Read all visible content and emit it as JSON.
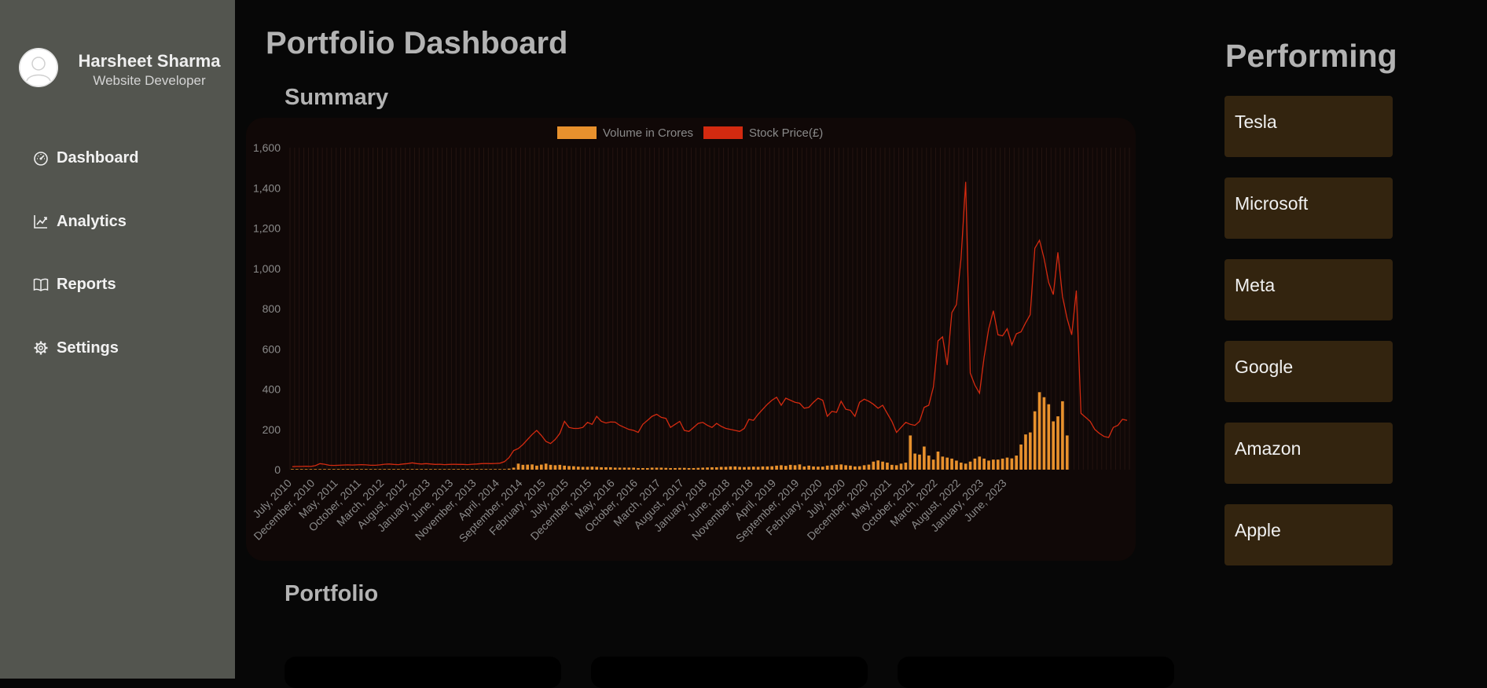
{
  "sidebar": {
    "user": {
      "name": "Harsheet Sharma",
      "role": "Website Developer"
    },
    "items": [
      {
        "label": "Dashboard",
        "icon": "gauge-icon"
      },
      {
        "label": "Analytics",
        "icon": "line-chart-icon"
      },
      {
        "label": "Reports",
        "icon": "book-icon"
      },
      {
        "label": "Settings",
        "icon": "gear-icon"
      }
    ]
  },
  "main": {
    "title": "Portfolio Dashboard",
    "summary_heading": "Summary",
    "portfolio_heading": "Portfolio"
  },
  "performing": {
    "title": "Performing",
    "items": [
      "Tesla",
      "Microsoft",
      "Meta",
      "Google",
      "Amazon",
      "Apple"
    ]
  },
  "colors": {
    "volume": "#e8912d",
    "price": "#d32a10",
    "sidebar_bg": "#53554f",
    "card_bg": "#33240f"
  },
  "chart_data": {
    "type": "bar",
    "legend": {
      "position": "top-center",
      "entries": [
        "Volume in Crores",
        "Stock Price(£)"
      ]
    },
    "ylim": [
      0,
      1600
    ],
    "y_ticks": [
      "0",
      "200",
      "400",
      "600",
      "800",
      "1,000",
      "1,200",
      "1,400",
      "1,600"
    ],
    "x_tick_labels": [
      "July, 2010",
      "December, 2010",
      "May, 2011",
      "October, 2011",
      "March, 2012",
      "August, 2012",
      "January, 2013",
      "June, 2013",
      "November, 2013",
      "April, 2014",
      "September, 2014",
      "February, 2015",
      "July, 2015",
      "December, 2015",
      "May, 2016",
      "October, 2016",
      "March, 2017",
      "August, 2017",
      "January, 2018",
      "June, 2018",
      "November, 2018",
      "April, 2019",
      "September, 2019",
      "February, 2020",
      "July, 2020",
      "December, 2020",
      "May, 2021",
      "October, 2021",
      "March, 2022",
      "August, 2022",
      "January, 2023",
      "June, 2023"
    ],
    "x_start": "July, 2010",
    "x_end": "August, 2023",
    "grid": true,
    "series": [
      {
        "name": "Volume in Crores",
        "type": "bar",
        "color": "#e8912d",
        "values": [
          3,
          3,
          3,
          3,
          3,
          3,
          3,
          3,
          3,
          3,
          3,
          3,
          3,
          3,
          3,
          3,
          3,
          3,
          3,
          3,
          3,
          3,
          3,
          3,
          3,
          3,
          3,
          3,
          3,
          3,
          3,
          3,
          3,
          3,
          3,
          3,
          3,
          3,
          3,
          3,
          3,
          3,
          3,
          3,
          3,
          3,
          3,
          5,
          10,
          30,
          24,
          25,
          26,
          20,
          25,
          30,
          24,
          22,
          24,
          20,
          18,
          17,
          15,
          14,
          14,
          15,
          14,
          12,
          12,
          12,
          10,
          10,
          10,
          10,
          10,
          8,
          8,
          8,
          10,
          10,
          10,
          9,
          8,
          8,
          9,
          9,
          8,
          8,
          9,
          10,
          11,
          12,
          12,
          14,
          14,
          16,
          16,
          14,
          13,
          14,
          15,
          14,
          16,
          16,
          17,
          20,
          22,
          19,
          24,
          22,
          26,
          16,
          20,
          16,
          15,
          15,
          20,
          22,
          24,
          26,
          22,
          20,
          16,
          17,
          22,
          25,
          40,
          46,
          40,
          35,
          24,
          22,
          30,
          35,
          170,
          80,
          75,
          115,
          70,
          50,
          90,
          65,
          60,
          55,
          45,
          35,
          30,
          40,
          55,
          65,
          55,
          45,
          50,
          50,
          55,
          60,
          56,
          70,
          125,
          175,
          185,
          290,
          385,
          360,
          325,
          240,
          265,
          340,
          170
        ]
      },
      {
        "name": "Stock Price(£)",
        "type": "line",
        "color": "#d32a10",
        "values": [
          15,
          16,
          16,
          17,
          16,
          20,
          30,
          27,
          22,
          21,
          22,
          23,
          24,
          23,
          24,
          25,
          24,
          22,
          22,
          24,
          27,
          28,
          26,
          25,
          28,
          30,
          34,
          30,
          28,
          30,
          28,
          26,
          27,
          25,
          26,
          27,
          26,
          26,
          25,
          27,
          28,
          30,
          31,
          30,
          31,
          32,
          40,
          60,
          95,
          105,
          125,
          150,
          175,
          195,
          170,
          140,
          130,
          150,
          180,
          240,
          210,
          205,
          205,
          210,
          235,
          225,
          265,
          240,
          232,
          237,
          236,
          220,
          210,
          200,
          195,
          185,
          225,
          245,
          265,
          275,
          260,
          255,
          210,
          225,
          240,
          195,
          190,
          210,
          230,
          235,
          220,
          210,
          230,
          215,
          205,
          200,
          195,
          190,
          205,
          250,
          245,
          275,
          300,
          325,
          345,
          360,
          320,
          355,
          345,
          335,
          330,
          305,
          310,
          335,
          355,
          345,
          265,
          290,
          285,
          340,
          300,
          295,
          265,
          335,
          350,
          340,
          325,
          305,
          320,
          280,
          240,
          185,
          210,
          235,
          225,
          220,
          240,
          310,
          320,
          410,
          640,
          660,
          520,
          780,
          820,
          1050,
          1430,
          480,
          420,
          380,
          560,
          700,
          790,
          670,
          665,
          700,
          620,
          675,
          685,
          730,
          770,
          1100,
          1140,
          1050,
          930,
          870,
          1080,
          860,
          750,
          670,
          890,
          280,
          260,
          240,
          200,
          180,
          165,
          160,
          210,
          220,
          250,
          245
        ]
      }
    ]
  }
}
